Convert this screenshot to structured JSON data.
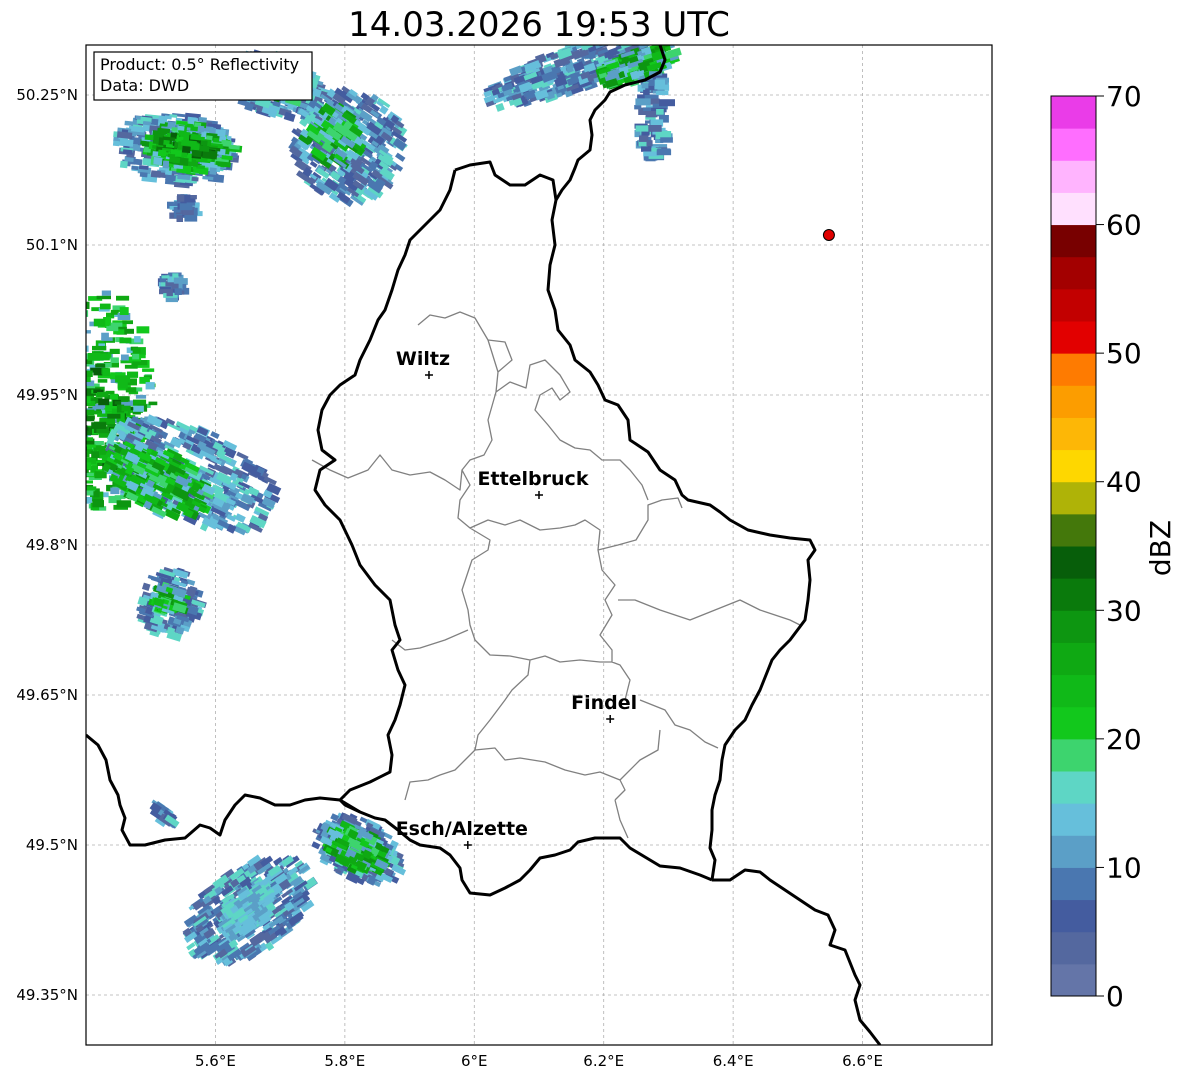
{
  "title": "14.03.2026 19:53 UTC",
  "info": {
    "product": "Product: 0.5° Reflectivity",
    "data": "Data: DWD"
  },
  "map": {
    "lon_range": [
      5.4,
      6.8
    ],
    "lat_range": [
      49.3,
      50.3
    ],
    "lon_ticks": [
      {
        "value": 5.6,
        "label": "5.6°E"
      },
      {
        "value": 5.8,
        "label": "5.8°E"
      },
      {
        "value": 6.0,
        "label": "6°E"
      },
      {
        "value": 6.2,
        "label": "6.2°E"
      },
      {
        "value": 6.4,
        "label": "6.4°E"
      },
      {
        "value": 6.6,
        "label": "6.6°E"
      }
    ],
    "lat_ticks": [
      {
        "value": 50.25,
        "label": "50.25°N"
      },
      {
        "value": 50.1,
        "label": "50.1°N"
      },
      {
        "value": 49.95,
        "label": "49.95°N"
      },
      {
        "value": 49.8,
        "label": "49.8°N"
      },
      {
        "value": 49.65,
        "label": "49.65°N"
      },
      {
        "value": 49.5,
        "label": "49.5°N"
      },
      {
        "value": 49.35,
        "label": "49.35°N"
      }
    ],
    "cities": [
      {
        "name": "Wiltz",
        "lon": 5.93,
        "lat": 49.97
      },
      {
        "name": "Ettelbruck",
        "lon": 6.1,
        "lat": 49.85
      },
      {
        "name": "Findel",
        "lon": 6.21,
        "lat": 49.626
      },
      {
        "name": "Esch/Alzette",
        "lon": 5.99,
        "lat": 49.5
      }
    ],
    "radar_site": {
      "lon": 6.548,
      "lat": 50.11,
      "color": "#e00000"
    }
  },
  "colorbar": {
    "label": "dBZ",
    "min": 0,
    "max": 70,
    "step": 2.5,
    "ticks": [
      0,
      10,
      20,
      30,
      40,
      50,
      60,
      70
    ],
    "colors": [
      "#6475a8",
      "#54689f",
      "#445c9f",
      "#4a77b0",
      "#5b9fc7",
      "#66bfdb",
      "#5ed6c5",
      "#3dd46e",
      "#12c81c",
      "#10b918",
      "#0fa913",
      "#0d9611",
      "#0a7a0c",
      "#075e0a",
      "#44780b",
      "#afb307",
      "#fed700",
      "#fdb706",
      "#fc9d00",
      "#fe7b01",
      "#e20000",
      "#c20000",
      "#a30000",
      "#780000",
      "#ffe0fe",
      "#ffb4fe",
      "#ff6eff",
      "#ea3ce8"
    ]
  }
}
